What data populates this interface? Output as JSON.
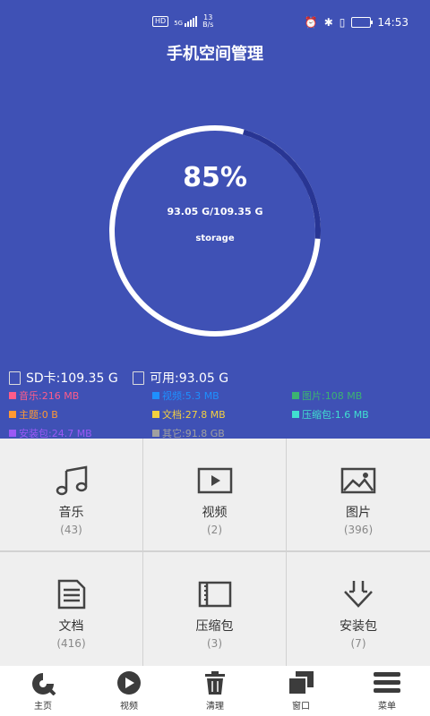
{
  "status": {
    "hd": "HD",
    "network": "5G",
    "speed_value": "13",
    "speed_unit": "B/s",
    "time": "14:53"
  },
  "header": {
    "title": "手机空间管理"
  },
  "usage": {
    "percent": "85%",
    "used_total": "93.05 G/109.35 G",
    "label": "storage",
    "fraction": 0.85
  },
  "summary": {
    "sd": "SD卡:109.35 G",
    "free": "可用:93.05 G"
  },
  "legend": [
    {
      "text": "音乐:216 MB",
      "color": "#ff5c8a"
    },
    {
      "text": "视频:5.3 MB",
      "color": "#1e90ff"
    },
    {
      "text": "图片:108 MB",
      "color": "#3cb371"
    },
    {
      "text": "主题:0 B",
      "color": "#ff9933"
    },
    {
      "text": "文档:27.8 MB",
      "color": "#f4d03f"
    },
    {
      "text": "压缩包:1.6 MB",
      "color": "#40e0d0"
    },
    {
      "text": "安装包:24.7 MB",
      "color": "#9b59f5"
    },
    {
      "text": "其它:91.8 GB",
      "color": "#a0a0a0"
    }
  ],
  "grid": [
    {
      "label": "音乐",
      "count": "(43)",
      "icon": "music-icon"
    },
    {
      "label": "视频",
      "count": "(2)",
      "icon": "video-icon"
    },
    {
      "label": "图片",
      "count": "(396)",
      "icon": "image-icon"
    },
    {
      "label": "文档",
      "count": "(416)",
      "icon": "document-icon"
    },
    {
      "label": "压缩包",
      "count": "(3)",
      "icon": "archive-icon"
    },
    {
      "label": "安装包",
      "count": "(7)",
      "icon": "download-icon"
    }
  ],
  "nav": [
    {
      "label": "主页",
      "icon": "home-icon"
    },
    {
      "label": "视频",
      "icon": "play-icon"
    },
    {
      "label": "清理",
      "icon": "trash-icon"
    },
    {
      "label": "窗口",
      "icon": "windows-icon"
    },
    {
      "label": "菜单",
      "icon": "menu-icon"
    }
  ],
  "colors": {
    "primary": "#3f51b5",
    "ring": "#ffffff",
    "ring_used": "#283593"
  }
}
